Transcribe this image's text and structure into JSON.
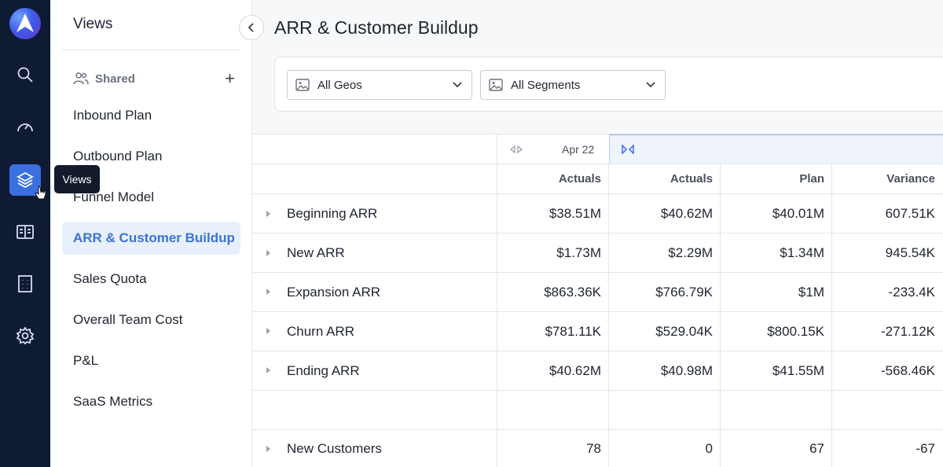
{
  "tooltip": {
    "label": "Views"
  },
  "views_panel": {
    "title": "Views",
    "shared_label": "Shared",
    "items": [
      {
        "label": "Inbound Plan"
      },
      {
        "label": "Outbound Plan"
      },
      {
        "label": "Funnel Model"
      },
      {
        "label": "ARR & Customer Buildup"
      },
      {
        "label": "Sales Quota"
      },
      {
        "label": "Overall Team Cost"
      },
      {
        "label": "P&L"
      },
      {
        "label": "SaaS Metrics"
      }
    ],
    "active_index": 3
  },
  "main": {
    "title": "ARR & Customer Buildup",
    "filters": [
      {
        "label": "All Geos"
      },
      {
        "label": "All Segments"
      }
    ]
  },
  "table": {
    "period_label": "Apr 22",
    "columns": [
      "Actuals",
      "Actuals",
      "Plan",
      "Variance"
    ],
    "rows": [
      {
        "label": "Beginning ARR",
        "values": [
          "$38.51M",
          "$40.62M",
          "$40.01M",
          "607.51K"
        ]
      },
      {
        "label": "New ARR",
        "values": [
          "$1.73M",
          "$2.29M",
          "$1.34M",
          "945.54K"
        ]
      },
      {
        "label": "Expansion ARR",
        "values": [
          "$863.36K",
          "$766.79K",
          "$1M",
          "-233.4K"
        ]
      },
      {
        "label": "Churn ARR",
        "values": [
          "$781.11K",
          "$529.04K",
          "$800.15K",
          "-271.12K"
        ]
      },
      {
        "label": "Ending ARR",
        "values": [
          "$40.62M",
          "$40.98M",
          "$41.55M",
          "-568.46K"
        ]
      },
      {
        "label": "",
        "values": [
          "",
          "",
          "",
          ""
        ]
      },
      {
        "label": "New Customers",
        "values": [
          "78",
          "0",
          "67",
          "-67"
        ]
      }
    ]
  },
  "colors": {
    "rail": "#0f1b33",
    "accent": "#3a6fe0",
    "active_view_bg": "#e8f0fc",
    "active_view_text": "#3a74d6"
  }
}
